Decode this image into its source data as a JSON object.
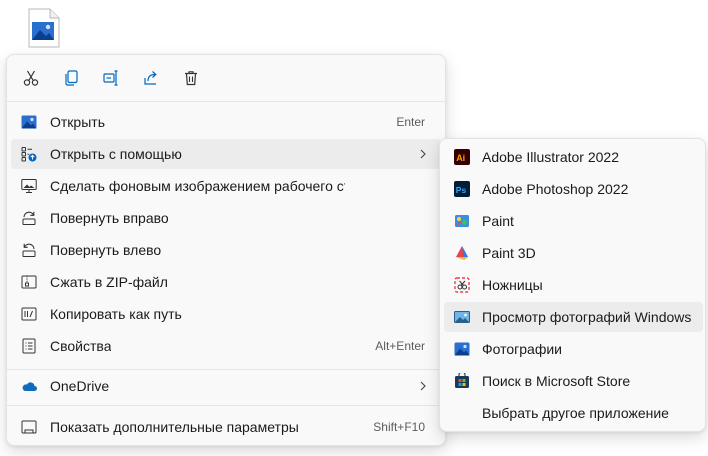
{
  "file": {
    "icon": "image-file-icon"
  },
  "quick_actions": [
    {
      "name": "cut",
      "icon": "scissors-icon"
    },
    {
      "name": "copy",
      "icon": "copy-icon"
    },
    {
      "name": "rename",
      "icon": "rename-icon"
    },
    {
      "name": "share",
      "icon": "share-icon"
    },
    {
      "name": "delete",
      "icon": "trash-icon"
    }
  ],
  "menu": {
    "open": {
      "label": "Открыть",
      "shortcut": "Enter"
    },
    "open_with": {
      "label": "Открыть с помощью"
    },
    "set_wallpaper": {
      "label": "Сделать фоновым изображением рабочего стола"
    },
    "rotate_right": {
      "label": "Повернуть вправо"
    },
    "rotate_left": {
      "label": "Повернуть влево"
    },
    "zip": {
      "label": "Сжать в ZIP-файл"
    },
    "copy_path": {
      "label": "Копировать как путь"
    },
    "properties": {
      "label": "Свойства",
      "shortcut": "Alt+Enter"
    },
    "onedrive": {
      "label": "OneDrive"
    },
    "more_options": {
      "label": "Показать дополнительные параметры",
      "shortcut": "Shift+F10"
    }
  },
  "open_with_submenu": {
    "items": [
      {
        "label": "Adobe Illustrator 2022",
        "icon": "adobe-illustrator-icon"
      },
      {
        "label": "Adobe Photoshop 2022",
        "icon": "adobe-photoshop-icon"
      },
      {
        "label": "Paint",
        "icon": "paint-icon"
      },
      {
        "label": "Paint 3D",
        "icon": "paint-3d-icon"
      },
      {
        "label": "Ножницы",
        "icon": "snipping-tool-icon"
      },
      {
        "label": "Просмотр фотографий Windows",
        "icon": "photo-viewer-icon"
      },
      {
        "label": "Фотографии",
        "icon": "photos-icon"
      },
      {
        "label": "Поиск в Microsoft Store",
        "icon": "microsoft-store-icon"
      },
      {
        "label": "Выбрать другое приложение",
        "icon": ""
      }
    ]
  },
  "colors": {
    "accent": "#0067c0",
    "menu_bg": "#f9f9f9",
    "hover_bg": "#ececec"
  }
}
